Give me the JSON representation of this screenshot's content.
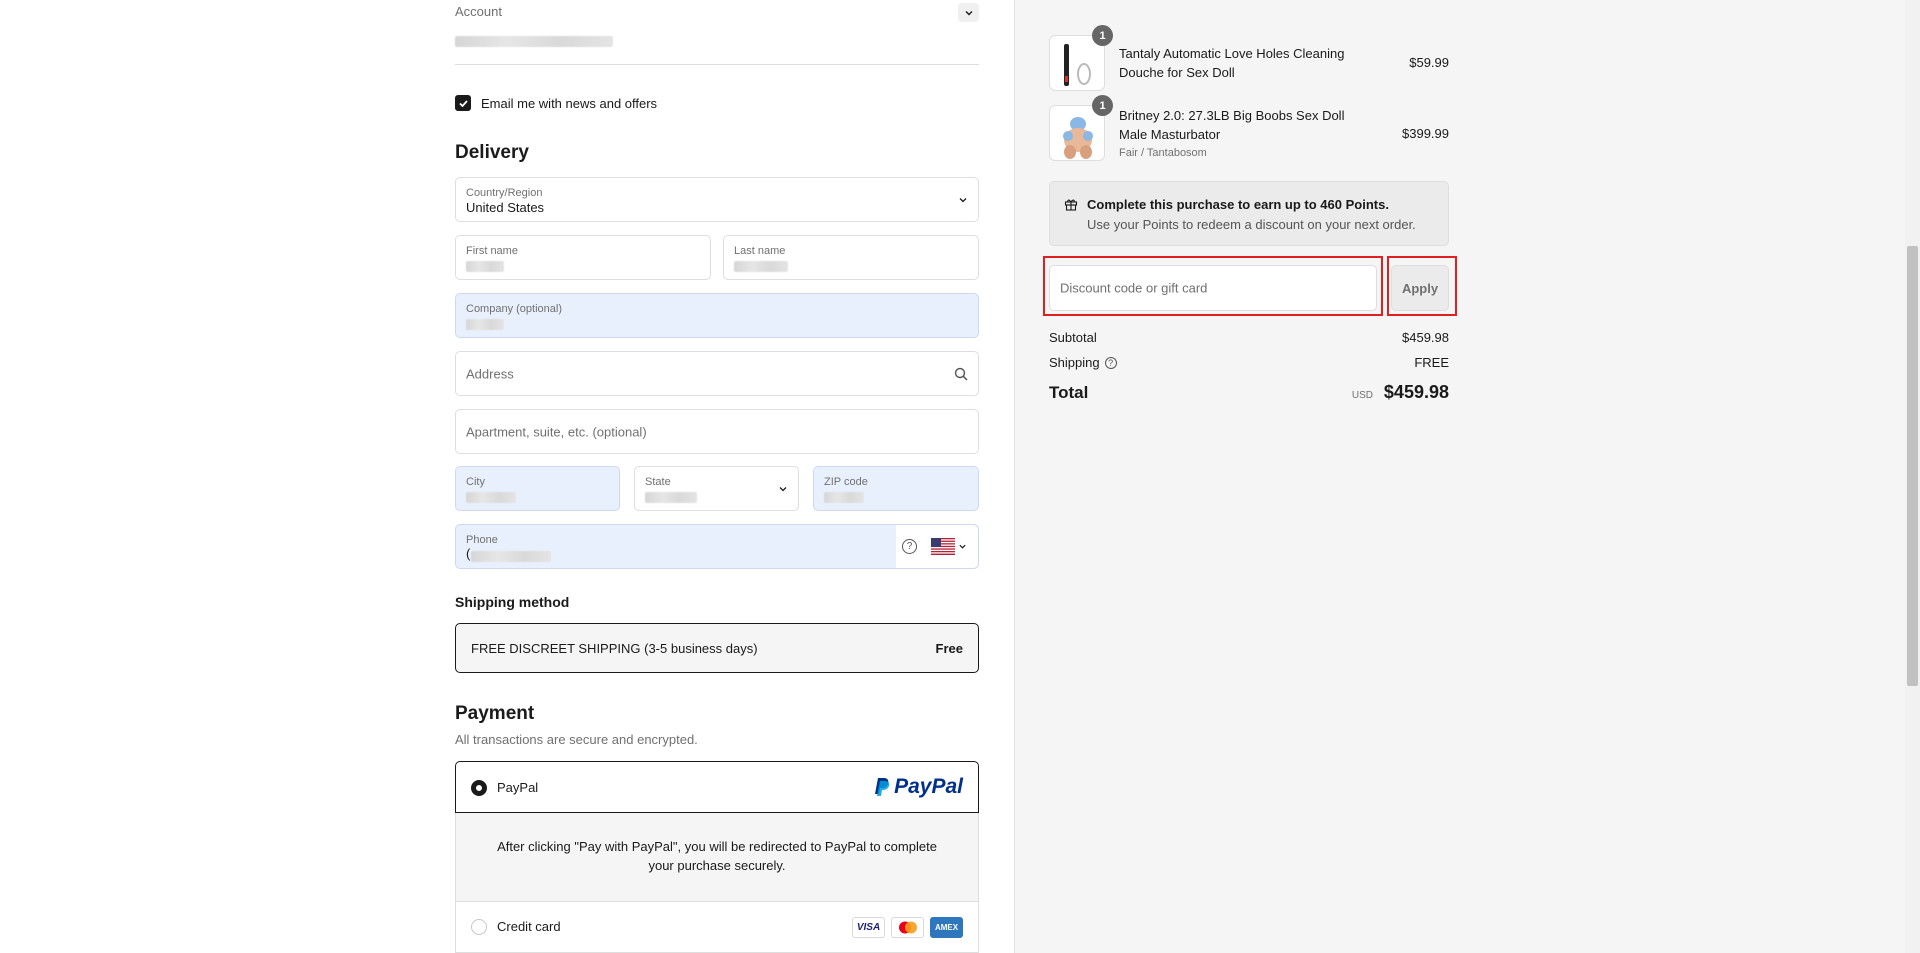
{
  "account": {
    "label": "Account"
  },
  "newsletter": {
    "label": "Email me with news and offers",
    "checked": true
  },
  "delivery": {
    "title": "Delivery",
    "country_label": "Country/Region",
    "country_value": "United States",
    "first_name_label": "First name",
    "last_name_label": "Last name",
    "company_label": "Company (optional)",
    "address_placeholder": "Address",
    "apartment_placeholder": "Apartment, suite, etc. (optional)",
    "city_label": "City",
    "state_label": "State",
    "zip_label": "ZIP code",
    "phone_label": "Phone",
    "phone_prefix": "("
  },
  "shipping": {
    "title": "Shipping method",
    "option_name": "FREE DISCREET SHIPPING (3-5 business days)",
    "option_price": "Free"
  },
  "payment": {
    "title": "Payment",
    "subtitle": "All transactions are secure and encrypted.",
    "paypal_label": "PayPal",
    "paypal_logo_text": "PayPal",
    "paypal_info": "After clicking \"Pay with PayPal\", you will be redirected to PayPal to complete your purchase securely.",
    "credit_card_label": "Credit card",
    "cards": [
      "VISA",
      "AMEX"
    ]
  },
  "cart": {
    "items": [
      {
        "name": "Tantaly Automatic Love Holes Cleaning Douche for Sex Doll",
        "variant": "",
        "quantity": "1",
        "price": "$59.99"
      },
      {
        "name": "Britney 2.0: 27.3LB Big Boobs Sex Doll Male Masturbator",
        "variant": "Fair / Tantabosom",
        "quantity": "1",
        "price": "$399.99"
      }
    ]
  },
  "points": {
    "title": "Complete this purchase to earn up to 460 Points.",
    "subtitle": "Use your Points to redeem a discount on your next order."
  },
  "discount": {
    "placeholder": "Discount code or gift card",
    "apply_label": "Apply"
  },
  "summary": {
    "subtotal_label": "Subtotal",
    "subtotal_value": "$459.98",
    "shipping_label": "Shipping",
    "shipping_value": "FREE",
    "total_label": "Total",
    "currency": "USD",
    "total_value": "$459.98"
  },
  "colors": {
    "highlight": "#e02020",
    "autofill": "#e8f0fe",
    "paypal_dark": "#003087",
    "paypal_light": "#009cde"
  }
}
